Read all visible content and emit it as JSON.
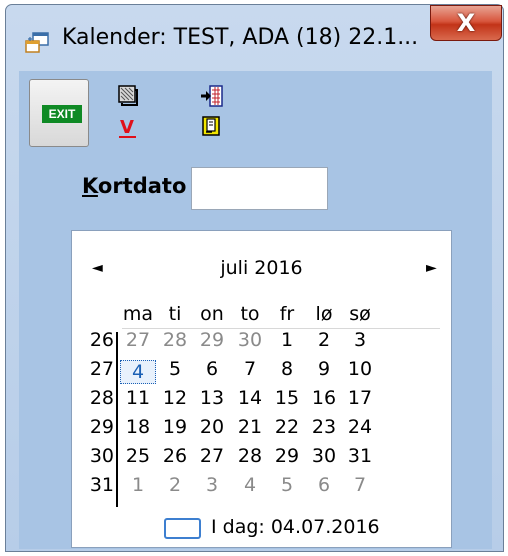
{
  "window": {
    "title": "Kalender: TEST, ADA (18) 22.1...",
    "close_label": "X"
  },
  "toolbar": {
    "exit_label": "EXIT",
    "icons": [
      "print-preview-icon",
      "check-v-icon",
      "import-icon",
      "clipboard-icon"
    ],
    "check_label": "V"
  },
  "kortdato": {
    "label_accel": "K",
    "label_rest": "ortdato",
    "value": ""
  },
  "calendar": {
    "month_title": "juli 2016",
    "prev_arrow": "◄",
    "next_arrow": "►",
    "weekdays": [
      "ma",
      "ti",
      "on",
      "to",
      "fr",
      "lø",
      "sø"
    ],
    "weeks": [
      {
        "week": "26",
        "days": [
          {
            "d": "27",
            "other": true
          },
          {
            "d": "28",
            "other": true
          },
          {
            "d": "29",
            "other": true
          },
          {
            "d": "30",
            "other": true
          },
          {
            "d": "1"
          },
          {
            "d": "2"
          },
          {
            "d": "3"
          }
        ]
      },
      {
        "week": "27",
        "days": [
          {
            "d": "4",
            "selected": true
          },
          {
            "d": "5"
          },
          {
            "d": "6"
          },
          {
            "d": "7"
          },
          {
            "d": "8"
          },
          {
            "d": "9"
          },
          {
            "d": "10"
          }
        ]
      },
      {
        "week": "28",
        "days": [
          {
            "d": "11"
          },
          {
            "d": "12"
          },
          {
            "d": "13"
          },
          {
            "d": "14"
          },
          {
            "d": "15"
          },
          {
            "d": "16"
          },
          {
            "d": "17"
          }
        ]
      },
      {
        "week": "29",
        "days": [
          {
            "d": "18"
          },
          {
            "d": "19"
          },
          {
            "d": "20"
          },
          {
            "d": "21"
          },
          {
            "d": "22"
          },
          {
            "d": "23"
          },
          {
            "d": "24"
          }
        ]
      },
      {
        "week": "30",
        "days": [
          {
            "d": "25"
          },
          {
            "d": "26"
          },
          {
            "d": "27"
          },
          {
            "d": "28"
          },
          {
            "d": "29"
          },
          {
            "d": "30"
          },
          {
            "d": "31"
          }
        ]
      },
      {
        "week": "31",
        "days": [
          {
            "d": "1",
            "other": true
          },
          {
            "d": "2",
            "other": true
          },
          {
            "d": "3",
            "other": true
          },
          {
            "d": "4",
            "other": true
          },
          {
            "d": "5",
            "other": true
          },
          {
            "d": "6",
            "other": true
          },
          {
            "d": "7",
            "other": true
          }
        ]
      }
    ],
    "today_label": "I dag: 04.07.2016"
  },
  "colors": {
    "client_bg": "#a8c4e4",
    "exit_green": "#0f8a25",
    "selected_day": "#1a5fb4",
    "close_red": "#c23318"
  }
}
